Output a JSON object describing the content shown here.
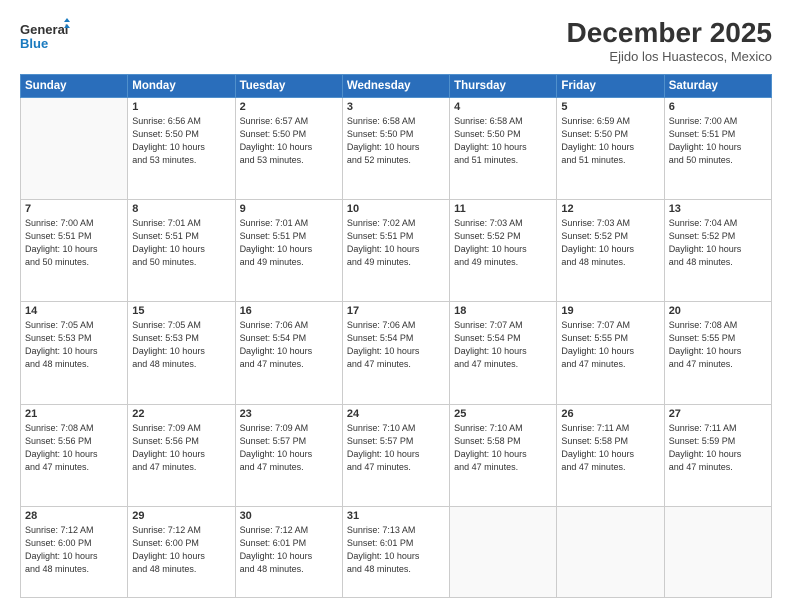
{
  "header": {
    "logo_line1": "General",
    "logo_line2": "Blue",
    "month": "December 2025",
    "location": "Ejido los Huastecos, Mexico"
  },
  "days_of_week": [
    "Sunday",
    "Monday",
    "Tuesday",
    "Wednesday",
    "Thursday",
    "Friday",
    "Saturday"
  ],
  "weeks": [
    [
      {
        "day": "",
        "info": ""
      },
      {
        "day": "1",
        "info": "Sunrise: 6:56 AM\nSunset: 5:50 PM\nDaylight: 10 hours\nand 53 minutes."
      },
      {
        "day": "2",
        "info": "Sunrise: 6:57 AM\nSunset: 5:50 PM\nDaylight: 10 hours\nand 53 minutes."
      },
      {
        "day": "3",
        "info": "Sunrise: 6:58 AM\nSunset: 5:50 PM\nDaylight: 10 hours\nand 52 minutes."
      },
      {
        "day": "4",
        "info": "Sunrise: 6:58 AM\nSunset: 5:50 PM\nDaylight: 10 hours\nand 51 minutes."
      },
      {
        "day": "5",
        "info": "Sunrise: 6:59 AM\nSunset: 5:50 PM\nDaylight: 10 hours\nand 51 minutes."
      },
      {
        "day": "6",
        "info": "Sunrise: 7:00 AM\nSunset: 5:51 PM\nDaylight: 10 hours\nand 50 minutes."
      }
    ],
    [
      {
        "day": "7",
        "info": "Sunrise: 7:00 AM\nSunset: 5:51 PM\nDaylight: 10 hours\nand 50 minutes."
      },
      {
        "day": "8",
        "info": "Sunrise: 7:01 AM\nSunset: 5:51 PM\nDaylight: 10 hours\nand 50 minutes."
      },
      {
        "day": "9",
        "info": "Sunrise: 7:01 AM\nSunset: 5:51 PM\nDaylight: 10 hours\nand 49 minutes."
      },
      {
        "day": "10",
        "info": "Sunrise: 7:02 AM\nSunset: 5:51 PM\nDaylight: 10 hours\nand 49 minutes."
      },
      {
        "day": "11",
        "info": "Sunrise: 7:03 AM\nSunset: 5:52 PM\nDaylight: 10 hours\nand 49 minutes."
      },
      {
        "day": "12",
        "info": "Sunrise: 7:03 AM\nSunset: 5:52 PM\nDaylight: 10 hours\nand 48 minutes."
      },
      {
        "day": "13",
        "info": "Sunrise: 7:04 AM\nSunset: 5:52 PM\nDaylight: 10 hours\nand 48 minutes."
      }
    ],
    [
      {
        "day": "14",
        "info": "Sunrise: 7:05 AM\nSunset: 5:53 PM\nDaylight: 10 hours\nand 48 minutes."
      },
      {
        "day": "15",
        "info": "Sunrise: 7:05 AM\nSunset: 5:53 PM\nDaylight: 10 hours\nand 48 minutes."
      },
      {
        "day": "16",
        "info": "Sunrise: 7:06 AM\nSunset: 5:54 PM\nDaylight: 10 hours\nand 47 minutes."
      },
      {
        "day": "17",
        "info": "Sunrise: 7:06 AM\nSunset: 5:54 PM\nDaylight: 10 hours\nand 47 minutes."
      },
      {
        "day": "18",
        "info": "Sunrise: 7:07 AM\nSunset: 5:54 PM\nDaylight: 10 hours\nand 47 minutes."
      },
      {
        "day": "19",
        "info": "Sunrise: 7:07 AM\nSunset: 5:55 PM\nDaylight: 10 hours\nand 47 minutes."
      },
      {
        "day": "20",
        "info": "Sunrise: 7:08 AM\nSunset: 5:55 PM\nDaylight: 10 hours\nand 47 minutes."
      }
    ],
    [
      {
        "day": "21",
        "info": "Sunrise: 7:08 AM\nSunset: 5:56 PM\nDaylight: 10 hours\nand 47 minutes."
      },
      {
        "day": "22",
        "info": "Sunrise: 7:09 AM\nSunset: 5:56 PM\nDaylight: 10 hours\nand 47 minutes."
      },
      {
        "day": "23",
        "info": "Sunrise: 7:09 AM\nSunset: 5:57 PM\nDaylight: 10 hours\nand 47 minutes."
      },
      {
        "day": "24",
        "info": "Sunrise: 7:10 AM\nSunset: 5:57 PM\nDaylight: 10 hours\nand 47 minutes."
      },
      {
        "day": "25",
        "info": "Sunrise: 7:10 AM\nSunset: 5:58 PM\nDaylight: 10 hours\nand 47 minutes."
      },
      {
        "day": "26",
        "info": "Sunrise: 7:11 AM\nSunset: 5:58 PM\nDaylight: 10 hours\nand 47 minutes."
      },
      {
        "day": "27",
        "info": "Sunrise: 7:11 AM\nSunset: 5:59 PM\nDaylight: 10 hours\nand 47 minutes."
      }
    ],
    [
      {
        "day": "28",
        "info": "Sunrise: 7:12 AM\nSunset: 6:00 PM\nDaylight: 10 hours\nand 48 minutes."
      },
      {
        "day": "29",
        "info": "Sunrise: 7:12 AM\nSunset: 6:00 PM\nDaylight: 10 hours\nand 48 minutes."
      },
      {
        "day": "30",
        "info": "Sunrise: 7:12 AM\nSunset: 6:01 PM\nDaylight: 10 hours\nand 48 minutes."
      },
      {
        "day": "31",
        "info": "Sunrise: 7:13 AM\nSunset: 6:01 PM\nDaylight: 10 hours\nand 48 minutes."
      },
      {
        "day": "",
        "info": ""
      },
      {
        "day": "",
        "info": ""
      },
      {
        "day": "",
        "info": ""
      }
    ]
  ]
}
